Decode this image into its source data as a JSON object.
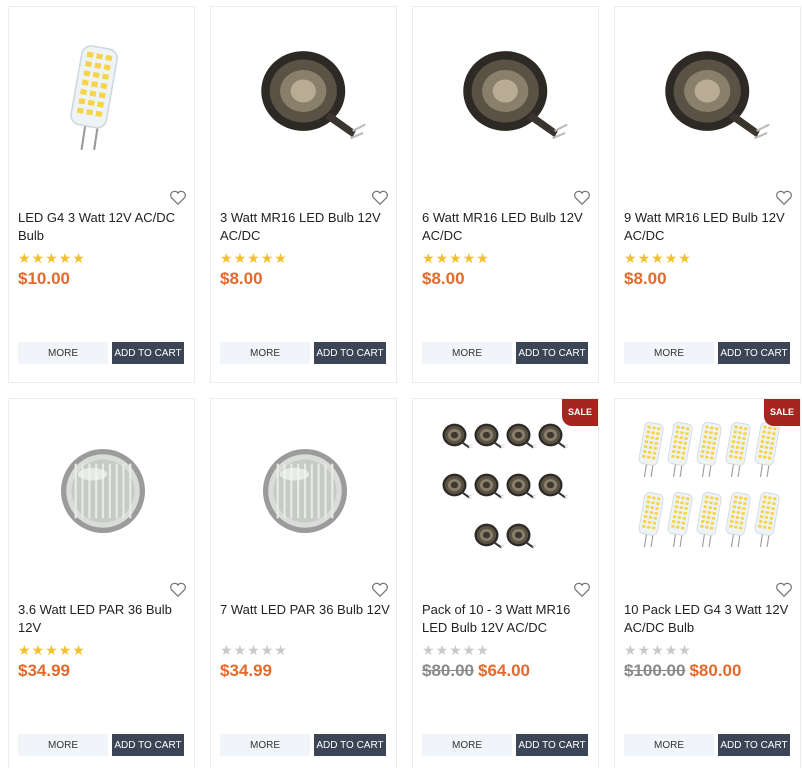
{
  "products": [
    {
      "title": "LED G4 3 Watt 12V AC/DC Bulb",
      "rating": 5,
      "old_price": "",
      "price": "$10.00",
      "more_label": "MORE",
      "cart_label": "ADD TO CART",
      "sale_label": "",
      "image_icon": "g4-led-bulb-icon"
    },
    {
      "title": "3 Watt MR16 LED Bulb 12V AC/DC",
      "rating": 5,
      "old_price": "",
      "price": "$8.00",
      "more_label": "MORE",
      "cart_label": "ADD TO CART",
      "sale_label": "",
      "image_icon": "mr16-bulb-icon"
    },
    {
      "title": "6 Watt MR16 LED Bulb 12V AC/DC",
      "rating": 5,
      "old_price": "",
      "price": "$8.00",
      "more_label": "MORE",
      "cart_label": "ADD TO CART",
      "sale_label": "",
      "image_icon": "mr16-bulb-icon"
    },
    {
      "title": "9 Watt MR16 LED Bulb 12V AC/DC",
      "rating": 5,
      "old_price": "",
      "price": "$8.00",
      "more_label": "MORE",
      "cart_label": "ADD TO CART",
      "sale_label": "",
      "image_icon": "mr16-bulb-icon"
    },
    {
      "title": "3.6 Watt LED PAR 36 Bulb 12V",
      "rating": 5,
      "old_price": "",
      "price": "$34.99",
      "more_label": "MORE",
      "cart_label": "ADD TO CART",
      "sale_label": "",
      "image_icon": "par36-bulb-icon"
    },
    {
      "title": "7 Watt LED PAR 36 Bulb 12V",
      "rating": 0,
      "old_price": "",
      "price": "$34.99",
      "more_label": "MORE",
      "cart_label": "ADD TO CART",
      "sale_label": "",
      "image_icon": "par36-bulb-icon"
    },
    {
      "title": "Pack of 10 - 3 Watt MR16 LED Bulb 12V AC/DC",
      "rating": 0,
      "old_price": "$80.00",
      "price": "$64.00",
      "more_label": "MORE",
      "cart_label": "ADD TO CART",
      "sale_label": "SALE",
      "image_icon": "mr16-pack-icon"
    },
    {
      "title": "10 Pack LED G4 3 Watt 12V AC/DC Bulb",
      "rating": 0,
      "old_price": "$100.00",
      "price": "$80.00",
      "more_label": "MORE",
      "cart_label": "ADD TO CART",
      "sale_label": "SALE",
      "image_icon": "g4-pack-icon"
    }
  ],
  "colors": {
    "price": "#e36a2c",
    "star": "#f2c02e",
    "sale_badge": "#a5261f",
    "cart_button": "#3b4556"
  }
}
